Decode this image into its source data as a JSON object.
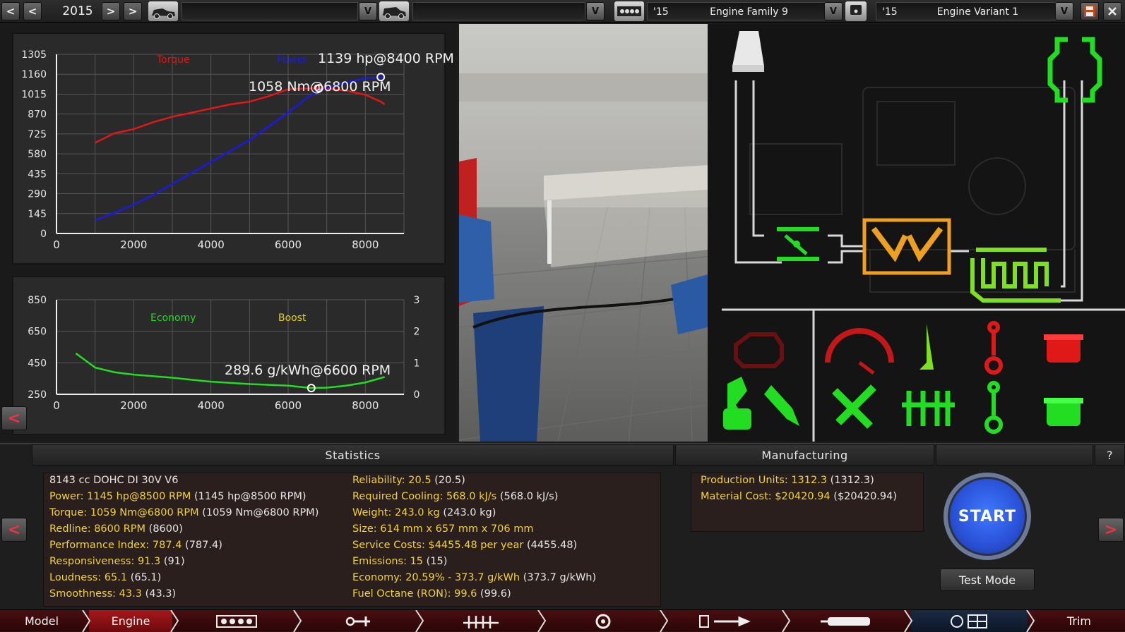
{
  "topbar": {
    "year": "2015",
    "family": {
      "year": "'15",
      "name": "Engine Family 9"
    },
    "variant": {
      "year": "'15",
      "name": "Engine Variant 1"
    },
    "btn_prev": "<",
    "btn_next": ">",
    "btn_v": "V"
  },
  "power_chart": {
    "title_torque": "Torque",
    "title_power": "Power",
    "torque_annotation": "1058 Nm@6800 RPM",
    "power_annotation": "1139 hp@8400 RPM",
    "colors": {
      "torque": "#e01818",
      "power": "#1a1ae8"
    }
  },
  "econ_chart": {
    "title_economy": "Economy",
    "title_boost": "Boost",
    "annotation": "289.6 g/kWh@6600 RPM",
    "colors": {
      "economy": "#22dd22",
      "boost": "#e8d020"
    }
  },
  "chart_data": [
    {
      "type": "line",
      "x": [
        1000,
        1500,
        2000,
        2500,
        3000,
        3500,
        4000,
        4500,
        5000,
        5500,
        6000,
        6500,
        6800,
        7000,
        7500,
        8000,
        8400,
        8500
      ],
      "series": [
        {
          "name": "Torque",
          "values": [
            660,
            730,
            760,
            810,
            850,
            880,
            910,
            940,
            960,
            1000,
            1050,
            1056,
            1058,
            1055,
            1040,
            1010,
            960,
            940
          ]
        },
        {
          "name": "Power",
          "values": [
            95,
            150,
            210,
            280,
            360,
            440,
            520,
            600,
            680,
            780,
            880,
            990,
            1040,
            1060,
            1100,
            1130,
            1139,
            1135
          ]
        }
      ],
      "xlim": [
        0,
        9000
      ],
      "ylim": [
        0,
        1305
      ],
      "yticks": [
        0,
        145,
        290,
        435,
        580,
        725,
        870,
        1015,
        1160,
        1305
      ],
      "xticks": [
        0,
        2000,
        4000,
        6000,
        8000
      ],
      "grid": true
    },
    {
      "type": "line",
      "x": [
        500,
        1000,
        1500,
        2000,
        3000,
        4000,
        5000,
        6000,
        6600,
        7000,
        7500,
        8000,
        8500
      ],
      "series": [
        {
          "name": "Economy",
          "values": [
            510,
            420,
            390,
            375,
            355,
            330,
            315,
            305,
            289.6,
            292,
            305,
            325,
            360
          ]
        }
      ],
      "xlim": [
        0,
        9000
      ],
      "ylim": [
        250,
        850
      ],
      "yticks": [
        250,
        450,
        650,
        850
      ],
      "y2ticks": [
        0,
        1,
        2,
        3
      ],
      "xticks": [
        0,
        2000,
        4000,
        6000,
        8000
      ],
      "grid": true
    }
  ],
  "statistics": {
    "header": "Statistics",
    "left": [
      {
        "label": "8143 cc DOHC DI 30V V6",
        "extra": ""
      },
      {
        "label": "Power: 1145 hp@8500 RPM",
        "extra": "(1145 hp@8500 RPM)"
      },
      {
        "label": "Torque: 1059 Nm@6800 RPM",
        "extra": "(1059 Nm@6800 RPM)"
      },
      {
        "label": "Redline: 8600 RPM",
        "extra": "(8600)"
      },
      {
        "label": "Performance Index: 787.4",
        "extra": "(787.4)"
      },
      {
        "label": "Responsiveness: 91.3",
        "extra": "(91)"
      },
      {
        "label": "Loudness: 65.1",
        "extra": "(65.1)"
      },
      {
        "label": "Smoothness: 43.3",
        "extra": "(43.3)"
      }
    ],
    "right": [
      {
        "label": "Reliability: 20.5",
        "extra": "(20.5)"
      },
      {
        "label": "Required Cooling: 568.0 kJ/s",
        "extra": "(568.0 kJ/s)"
      },
      {
        "label": "Weight: 243.0 kg",
        "extra": "(243.0 kg)"
      },
      {
        "label": "Size: 614 mm x 657 mm x 706 mm",
        "extra": ""
      },
      {
        "label": "Service Costs: $4455.48 per year",
        "extra": "(4455.48)"
      },
      {
        "label": "Emissions: 15",
        "extra": "(15)"
      },
      {
        "label": "Economy: 20.59% - 373.7 g/kWh",
        "extra": "(373.7 g/kWh)"
      },
      {
        "label": "Fuel Octane (RON): 99.6",
        "extra": "(99.6)"
      }
    ]
  },
  "manufacturing": {
    "header": "Manufacturing",
    "lines": [
      {
        "label": "Production Units: 1312.3",
        "extra": "(1312.3)"
      },
      {
        "label": "Material Cost: $20420.94",
        "extra": "($20420.94)"
      }
    ]
  },
  "actions": {
    "start": "START",
    "test_mode": "Test Mode",
    "help": "?"
  },
  "nav": {
    "model": "Model",
    "engine": "Engine",
    "trim": "Trim"
  }
}
